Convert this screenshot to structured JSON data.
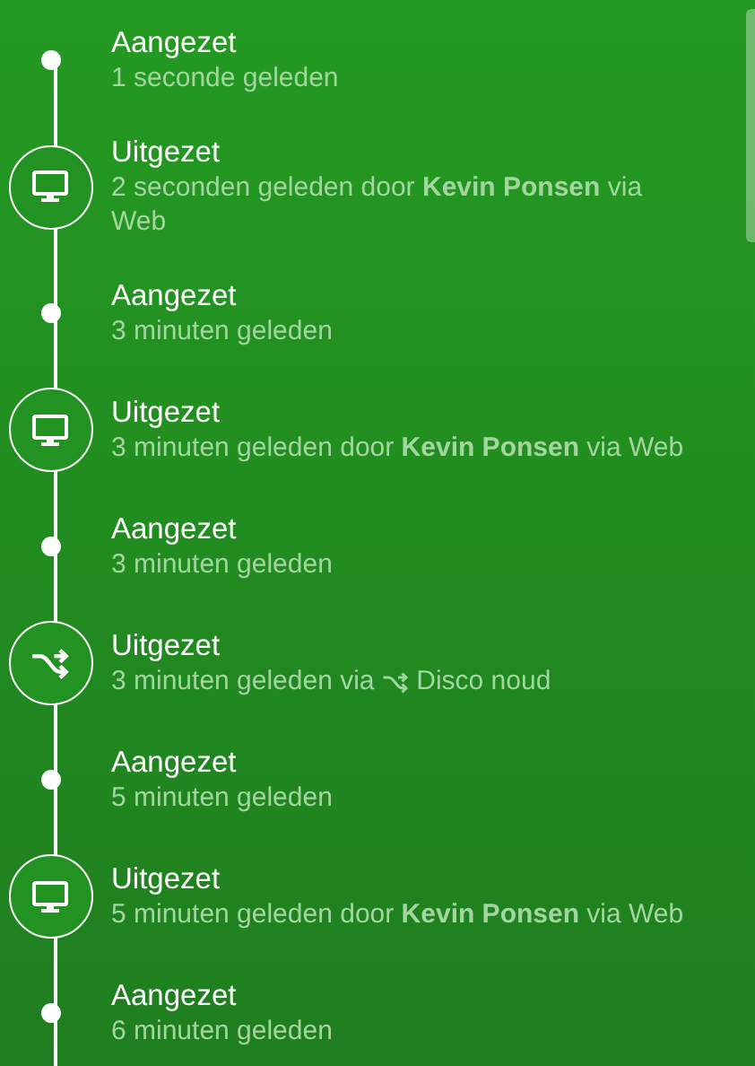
{
  "events": [
    {
      "kind": "dot",
      "title": "Aangezet",
      "detail": "1 seconde geleden"
    },
    {
      "kind": "web",
      "title": "Uitgezet",
      "detail": "2 seconden geleden door **Kevin Ponsen** via Web"
    },
    {
      "kind": "dot",
      "title": "Aangezet",
      "detail": "3 minuten geleden"
    },
    {
      "kind": "web",
      "title": "Uitgezet",
      "detail": "3 minuten geleden door **Kevin Ponsen** via Web"
    },
    {
      "kind": "dot",
      "title": "Aangezet",
      "detail": "3 minuten geleden"
    },
    {
      "kind": "scene",
      "title": "Uitgezet",
      "detail": "3 minuten geleden via",
      "scene": "Disco noud"
    },
    {
      "kind": "dot",
      "title": "Aangezet",
      "detail": "5 minuten geleden"
    },
    {
      "kind": "web",
      "title": "Uitgezet",
      "detail": "5 minuten geleden door **Kevin Ponsen** via Web"
    },
    {
      "kind": "dot",
      "title": "Aangezet",
      "detail": "6 minuten geleden"
    }
  ]
}
